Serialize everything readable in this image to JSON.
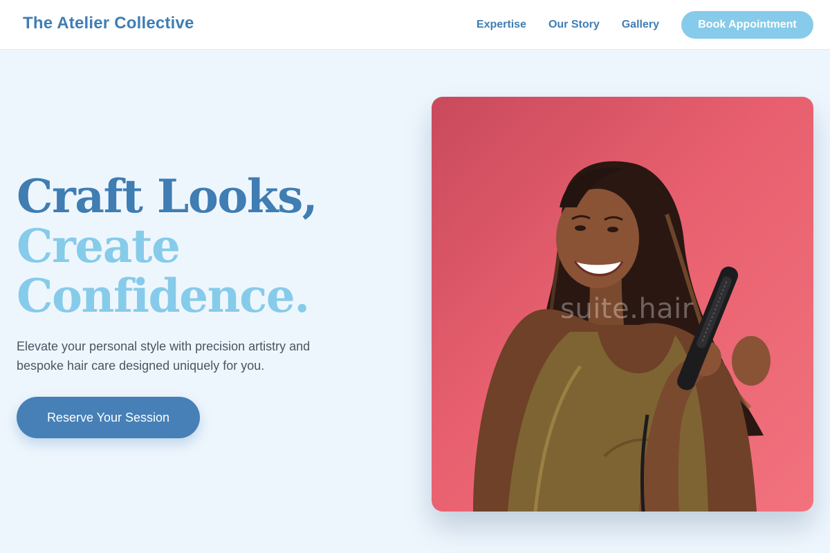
{
  "header": {
    "brand": "The Atelier Collective",
    "nav": [
      {
        "label": "Expertise"
      },
      {
        "label": "Our Story"
      },
      {
        "label": "Gallery"
      }
    ],
    "cta_label": "Book Appointment"
  },
  "hero": {
    "headline_line1": "Craft Looks,",
    "headline_line2": "Create",
    "headline_line3": "Confidence.",
    "subtitle": "Elevate your personal style with precision artistry and bespoke hair care designed uniquely for you.",
    "cta_label": "Reserve Your Session",
    "image": {
      "watermark": "suite.hair"
    }
  },
  "colors": {
    "brand_dark": "#3f7db3",
    "brand_light": "#86cbea",
    "page_bg": "#eef6fd",
    "image_bg": "#e8606f"
  }
}
